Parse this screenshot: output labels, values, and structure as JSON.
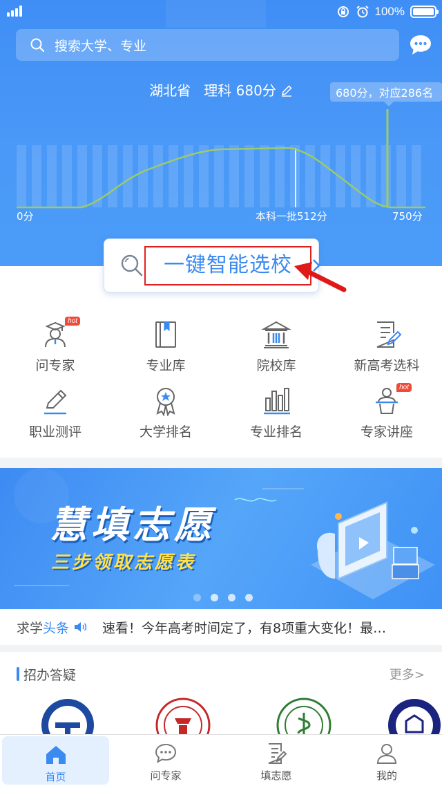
{
  "status_bar": {
    "battery_text": "100%"
  },
  "search": {
    "placeholder": "搜索大学、专业"
  },
  "score": {
    "province": "湖北省",
    "subject": "理科",
    "score_text": "680分"
  },
  "tooltip": "680分，对应286名",
  "chart_labels": {
    "min": "0分",
    "batch_line": "本科一批512分",
    "max": "750分"
  },
  "smart_select": {
    "label": "一键智能选校"
  },
  "menu": [
    {
      "label": "问专家",
      "icon": "expert-icon",
      "hot": "hot"
    },
    {
      "label": "专业库",
      "icon": "book-icon"
    },
    {
      "label": "院校库",
      "icon": "university-icon"
    },
    {
      "label": "新高考选科",
      "icon": "form-edit-icon"
    },
    {
      "label": "职业测评",
      "icon": "pencil-icon"
    },
    {
      "label": "大学排名",
      "icon": "medal-icon"
    },
    {
      "label": "专业排名",
      "icon": "bar-chart-icon"
    },
    {
      "label": "专家讲座",
      "icon": "lecture-icon",
      "hot": "hot"
    }
  ],
  "banner": {
    "title": "慧填志愿",
    "subtitle": "三步领取志愿表"
  },
  "news": {
    "tag_prefix": "求学",
    "tag_highlight": "头条",
    "text": "速看！今年高考时间定了，有8项重大变化！最…"
  },
  "section": {
    "title": "招办答疑",
    "more": "更多>"
  },
  "tabs": [
    {
      "label": "首页",
      "icon": "home-icon",
      "active": true
    },
    {
      "label": "问专家",
      "icon": "chat-icon"
    },
    {
      "label": "填志愿",
      "icon": "form-icon"
    },
    {
      "label": "我的",
      "icon": "user-icon"
    }
  ],
  "colors": {
    "primary": "#3a8af0",
    "hero": "#4a98f7",
    "curve": "#9ccc65",
    "highlight_box": "#e02020",
    "hot": "#f04a3a"
  }
}
